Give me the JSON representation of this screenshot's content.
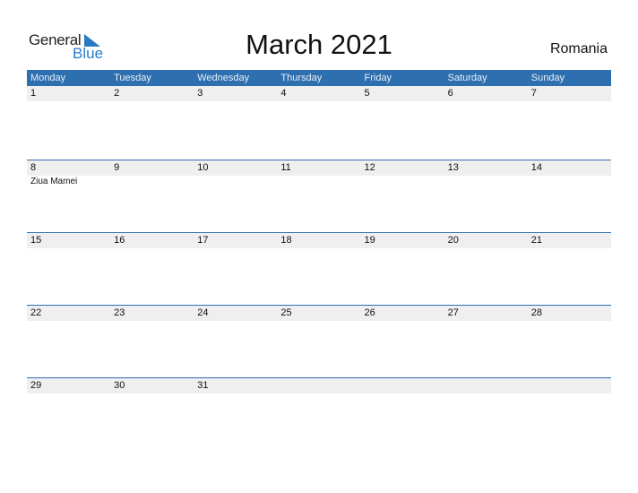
{
  "logo": {
    "general": "General",
    "blue": "Blue"
  },
  "title": "March 2021",
  "country": "Romania",
  "colors": {
    "header_bg": "#2e6faf",
    "date_bg": "#efefef",
    "brand_blue": "#2a7bc4"
  },
  "days": [
    "Monday",
    "Tuesday",
    "Wednesday",
    "Thursday",
    "Friday",
    "Saturday",
    "Sunday"
  ],
  "weeks": [
    {
      "dates": [
        "1",
        "2",
        "3",
        "4",
        "5",
        "6",
        "7"
      ],
      "events": [
        "",
        "",
        "",
        "",
        "",
        "",
        ""
      ]
    },
    {
      "dates": [
        "8",
        "9",
        "10",
        "11",
        "12",
        "13",
        "14"
      ],
      "events": [
        "Ziua Mamei",
        "",
        "",
        "",
        "",
        "",
        ""
      ]
    },
    {
      "dates": [
        "15",
        "16",
        "17",
        "18",
        "19",
        "20",
        "21"
      ],
      "events": [
        "",
        "",
        "",
        "",
        "",
        "",
        ""
      ]
    },
    {
      "dates": [
        "22",
        "23",
        "24",
        "25",
        "26",
        "27",
        "28"
      ],
      "events": [
        "",
        "",
        "",
        "",
        "",
        "",
        ""
      ]
    },
    {
      "dates": [
        "29",
        "30",
        "31",
        "",
        "",
        "",
        ""
      ],
      "events": [
        "",
        "",
        "",
        "",
        "",
        "",
        ""
      ]
    }
  ]
}
